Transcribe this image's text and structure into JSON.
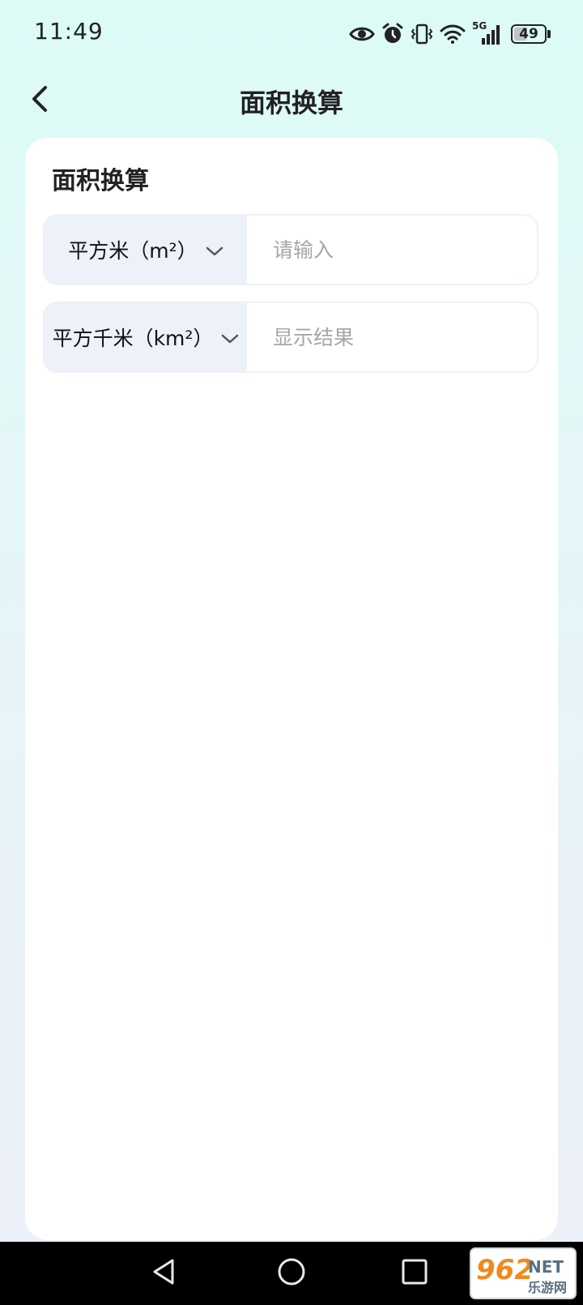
{
  "status_bar": {
    "time": "11:49",
    "icons": [
      "eye-icon",
      "alarm-icon",
      "vibrate-icon",
      "wifi-icon",
      "signal-5g-icon"
    ],
    "network_label": "5G",
    "battery_level": "49"
  },
  "header": {
    "title": "面积换算",
    "back_icon": "chevron-left-icon"
  },
  "card": {
    "title": "面积换算",
    "rows": [
      {
        "unit": "平方米（m²）",
        "input_value": "",
        "input_placeholder": "请输入"
      },
      {
        "unit": "平方千米（km²）",
        "input_value": "",
        "input_placeholder": "显示结果"
      }
    ]
  },
  "system_nav": {
    "buttons": [
      "back-triangle-icon",
      "home-circle-icon",
      "recents-square-icon"
    ]
  },
  "watermark": {
    "brand": "962",
    "suffix": "NET",
    "subtitle": "乐游网"
  },
  "colors": {
    "background_top": "#dcfbf7",
    "background_bottom": "#edf0f9",
    "card": "#ffffff",
    "unit_bg": "#edf1f9",
    "placeholder": "#a7a7a7",
    "text": "#222222"
  }
}
